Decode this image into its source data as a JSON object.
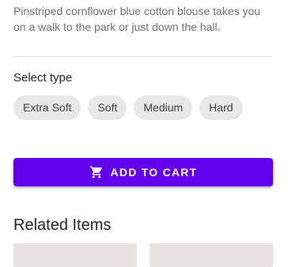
{
  "product": {
    "description": "Pinstriped cornflower blue cotton blouse takes you on a walk to the park or just down the hall."
  },
  "type_selector": {
    "label": "Select type",
    "options": [
      {
        "label": "Extra Soft"
      },
      {
        "label": "Soft"
      },
      {
        "label": "Medium"
      },
      {
        "label": "Hard"
      }
    ]
  },
  "cart_button": {
    "label": "ADD TO CART",
    "icon": "shopping-cart-icon",
    "color": "#6200ee"
  },
  "related": {
    "heading": "Related Items"
  },
  "colors": {
    "accent": "#6200ee",
    "chip_bg": "#e8e8e8",
    "description_text": "#6f6f6f",
    "card_placeholder": "#e9e4e2"
  }
}
